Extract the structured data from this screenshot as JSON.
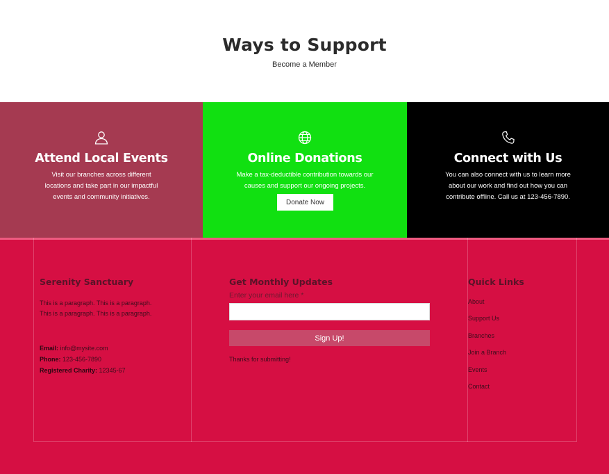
{
  "colors": {
    "band1_bg": "#a53a51",
    "band2_bg": "#11e011",
    "band3_bg": "#000000",
    "footer_bg": "#d60f43",
    "footer_strip": "#ee5a80",
    "signup_bg": "#c7496a"
  },
  "hero": {
    "title": "Ways to Support",
    "subtitle": "Become a Member"
  },
  "bands": [
    {
      "icon": "person-icon",
      "title": "Attend Local Events",
      "text": "Visit our branches across different locations and take part in our impactful events and community initiatives."
    },
    {
      "icon": "globe-icon",
      "title": "Online Donations",
      "text": "Make a tax-deductible contribution towards our causes and support our ongoing projects.",
      "button": "Donate Now"
    },
    {
      "icon": "phone-icon",
      "title": "Connect with Us",
      "text": "You can also connect with us to learn more about our work and find out how you can contribute offline. Call us at 123-456-7890."
    }
  ],
  "footer": {
    "org": {
      "title": "Serenity Sanctuary",
      "paragraph": "This is a paragraph. This is a paragraph. This is a paragraph. This is a paragraph.",
      "email_label": "Email:",
      "email": "info@mysite.com",
      "phone_label": "Phone:",
      "phone": "123-456-7890",
      "charity_label": "Registered Charity:",
      "charity": "12345-67"
    },
    "newsletter": {
      "title": "Get Monthly Updates",
      "email_label": "Enter your email here *",
      "email_value": "",
      "button": "Sign Up!",
      "thanks": "Thanks for submitting!"
    },
    "quick_links": {
      "title": "Quick Links",
      "items": [
        "About",
        "Support Us",
        "Branches",
        "Join a Branch",
        "Events",
        "Contact"
      ]
    }
  }
}
